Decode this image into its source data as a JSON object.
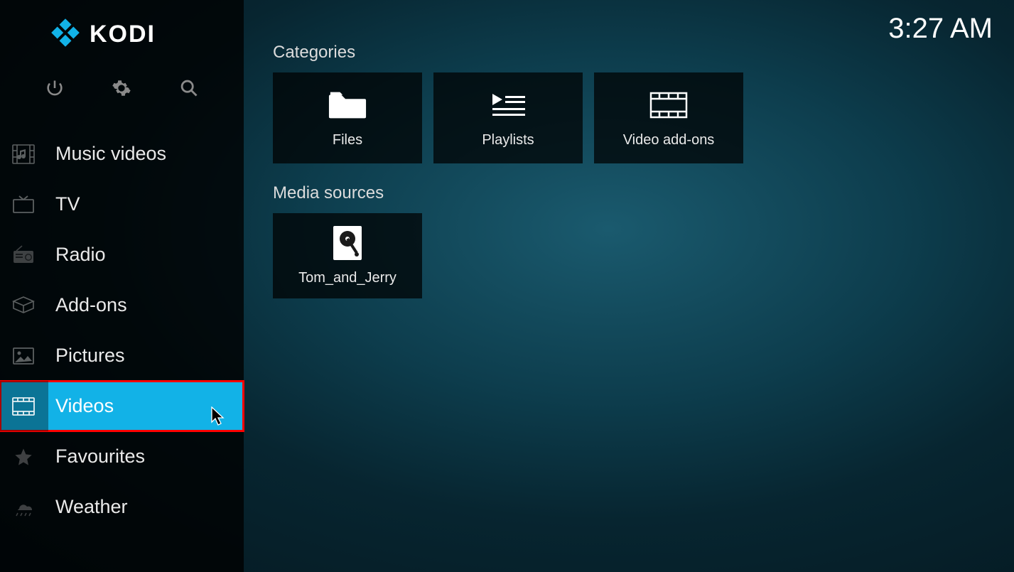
{
  "app": {
    "name": "KODI"
  },
  "clock": "3:27 AM",
  "sidebar": {
    "items": [
      {
        "label": "Music videos",
        "icon": "music-video-icon",
        "selected": false
      },
      {
        "label": "TV",
        "icon": "tv-icon",
        "selected": false
      },
      {
        "label": "Radio",
        "icon": "radio-icon",
        "selected": false
      },
      {
        "label": "Add-ons",
        "icon": "addons-icon",
        "selected": false
      },
      {
        "label": "Pictures",
        "icon": "pictures-icon",
        "selected": false
      },
      {
        "label": "Videos",
        "icon": "videos-icon",
        "selected": true
      },
      {
        "label": "Favourites",
        "icon": "star-icon",
        "selected": false
      },
      {
        "label": "Weather",
        "icon": "weather-icon",
        "selected": false
      }
    ]
  },
  "main": {
    "sections": [
      {
        "title": "Categories",
        "cards": [
          {
            "label": "Files",
            "icon": "folder-icon"
          },
          {
            "label": "Playlists",
            "icon": "playlist-icon"
          },
          {
            "label": "Video add-ons",
            "icon": "film-icon"
          }
        ]
      },
      {
        "title": "Media sources",
        "cards": [
          {
            "label": "Tom_and_Jerry",
            "icon": "harddrive-icon"
          }
        ]
      }
    ]
  }
}
